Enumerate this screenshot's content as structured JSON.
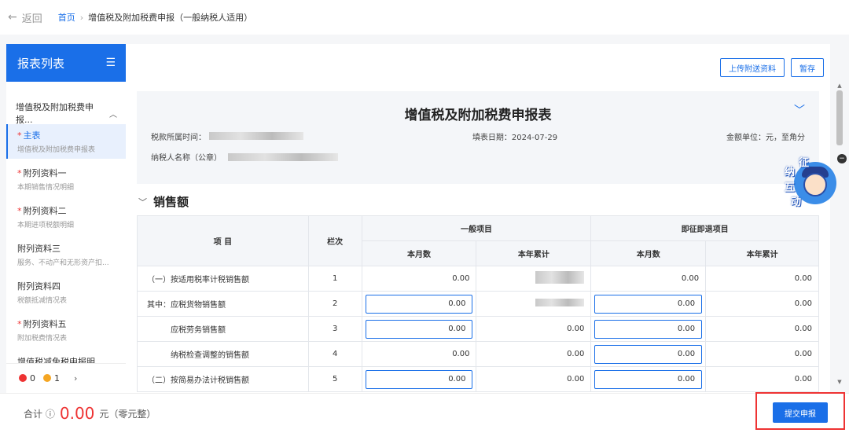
{
  "topbar": {
    "back_label": "返回",
    "crumb_home": "首页",
    "crumb_sep": "›",
    "crumb_current": "增值税及附加税费申报（一般纳税人适用）"
  },
  "sidebar": {
    "title": "报表列表",
    "group_title": "增值税及附加税费申报...",
    "items": [
      {
        "name": "主表",
        "sub": "增值税及附加税费申报表",
        "required": true
      },
      {
        "name": "附列资料一",
        "sub": "本期销售情况明细",
        "required": true
      },
      {
        "name": "附列资料二",
        "sub": "本期进项税额明细",
        "required": true
      },
      {
        "name": "附列资料三",
        "sub": "服务、不动产和无形资产扣...",
        "required": false
      },
      {
        "name": "附列资料四",
        "sub": "税额抵减情况表",
        "required": false
      },
      {
        "name": "附列资料五",
        "sub": "附加税费情况表",
        "required": true
      },
      {
        "name": "增值税减免税申报明...",
        "sub": "",
        "required": false
      }
    ],
    "status": {
      "errors": "0",
      "warnings": "1"
    }
  },
  "toolbar": {
    "upload_label": "上传附送资料",
    "save_label": "暂存"
  },
  "form": {
    "title": "增值税及附加税费申报表",
    "period_label": "税款所属时间：",
    "fill_date": "填表日期：2024-07-29",
    "amount_unit": "金额单位：元，至角分",
    "taxpayer_label": "纳税人名称（公章）"
  },
  "section": {
    "title": "销售额"
  },
  "table": {
    "headers": {
      "item": "项 目",
      "col": "栏次",
      "general": "一般项目",
      "immediate": "即征即退项目",
      "month": "本月数",
      "year": "本年累计"
    },
    "rows": [
      {
        "label": "（一）按适用税率计税销售额",
        "seq": "1",
        "gm": "0.00",
        "gy": "",
        "im": "0.00",
        "iy": "0.00"
      },
      {
        "label": "其中：应税货物销售额",
        "seq": "2",
        "gm": "0.00",
        "gy": "",
        "im": "0.00",
        "iy": "0.00"
      },
      {
        "label": "应税劳务销售额",
        "seq": "3",
        "gm": "0.00",
        "gy": "0.00",
        "im": "0.00",
        "iy": "0.00"
      },
      {
        "label": "纳税检查调整的销售额",
        "seq": "4",
        "gm": "0.00",
        "gy": "0.00",
        "im": "0.00",
        "iy": "0.00"
      },
      {
        "label": "（二）按简易办法计税销售额",
        "seq": "5",
        "gm": "0.00",
        "gy": "0.00",
        "im": "0.00",
        "iy": "0.00"
      }
    ]
  },
  "mascot": {
    "chars": [
      "征",
      "纳",
      "互",
      "动"
    ]
  },
  "footer": {
    "total_label": "合计",
    "amount": "0.00",
    "unit": "元（零元整）",
    "submit_label": "提交申报"
  },
  "colors": {
    "accent": "#1a6fe8",
    "danger": "#e33333",
    "warning": "#f5a623"
  }
}
